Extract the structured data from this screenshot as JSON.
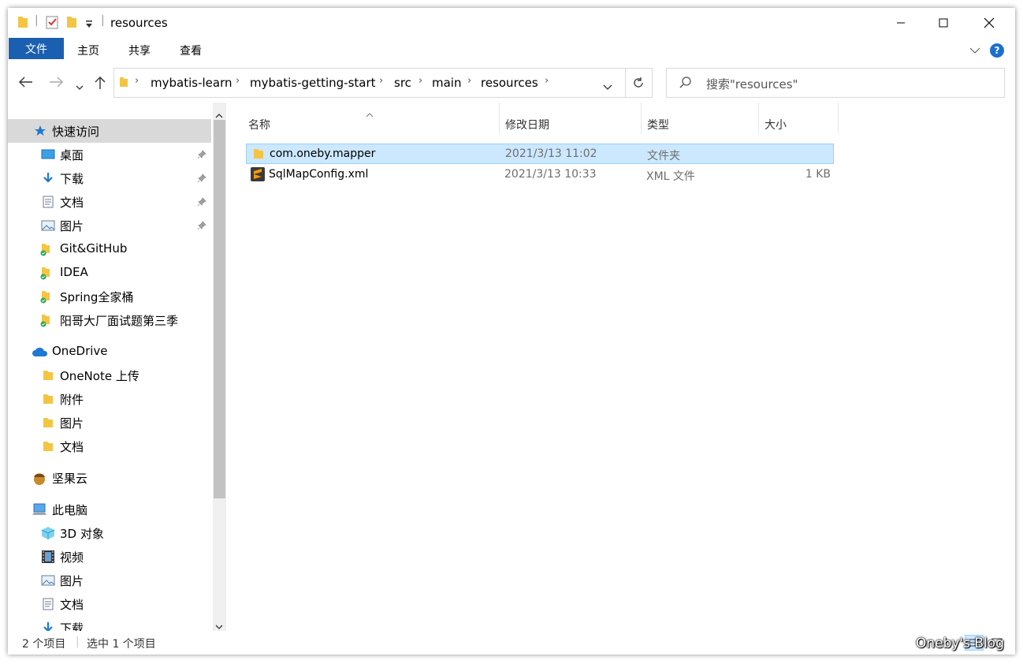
{
  "window": {
    "title": "resources",
    "minimize_icon": "minimize-icon",
    "maximize_icon": "maximize-icon",
    "close_icon": "close-icon"
  },
  "ribbon": {
    "file_tab": "文件",
    "tabs": [
      "主页",
      "共享",
      "查看"
    ]
  },
  "address": {
    "crumbs": [
      "mybatis-learn",
      "mybatis-getting-start",
      "src",
      "main",
      "resources"
    ]
  },
  "search": {
    "placeholder": "搜索\"resources\""
  },
  "sidebar": {
    "quick_access": "快速访问",
    "quick_items": [
      "桌面",
      "下载",
      "文档",
      "图片"
    ],
    "pinned_folders": [
      "Git&GitHub",
      "IDEA",
      "Spring全家桶",
      "阳哥大厂面试题第三季"
    ],
    "onedrive": "OneDrive",
    "onedrive_items": [
      "OneNote 上传",
      "附件",
      "图片",
      "文档"
    ],
    "nutstore": "坚果云",
    "this_pc": "此电脑",
    "pc_items": [
      "3D 对象",
      "视频",
      "图片",
      "文档",
      "下载"
    ]
  },
  "columns": {
    "name": "名称",
    "date": "修改日期",
    "type": "类型",
    "size": "大小"
  },
  "files": [
    {
      "name": "com.oneby.mapper",
      "date": "2021/3/13 11:02",
      "type": "文件夹",
      "size": "",
      "icon": "folder-icon",
      "selected": true
    },
    {
      "name": "SqlMapConfig.xml",
      "date": "2021/3/13 10:33",
      "type": "XML 文件",
      "size": "1 KB",
      "icon": "sublime-file-icon",
      "selected": false
    }
  ],
  "status": {
    "count": "2 个项目",
    "selected": "选中 1 个项目"
  },
  "watermark": "Oneby's Blog",
  "colors": {
    "accent": "#1b5fb0",
    "selection": "#cce8ff",
    "selection_border": "#99d1ff"
  }
}
